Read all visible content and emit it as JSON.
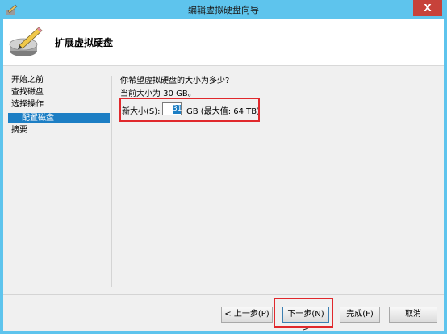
{
  "window": {
    "title": "编辑虚拟硬盘向导",
    "close_label": "X"
  },
  "header": {
    "title": "扩展虚拟硬盘"
  },
  "sidebar": {
    "items": [
      {
        "label": "开始之前"
      },
      {
        "label": "查找磁盘"
      },
      {
        "label": "选择操作"
      },
      {
        "label": "配置磁盘"
      },
      {
        "label": "摘要"
      }
    ]
  },
  "content": {
    "question": "你希望虚拟硬盘的大小为多少?",
    "current": "当前大小为 30 GB。",
    "size_label": "新大小(S):",
    "size_value": "31",
    "size_unit": "GB (最大值: 64 TB)"
  },
  "buttons": {
    "prev": "< 上一步(P)",
    "next": "下一步(N) >",
    "finish": "完成(F)",
    "cancel": "取消"
  },
  "colors": {
    "titlebar": "#5ec4ed",
    "accent": "#1c7ec4",
    "highlight": "#e0282c"
  }
}
